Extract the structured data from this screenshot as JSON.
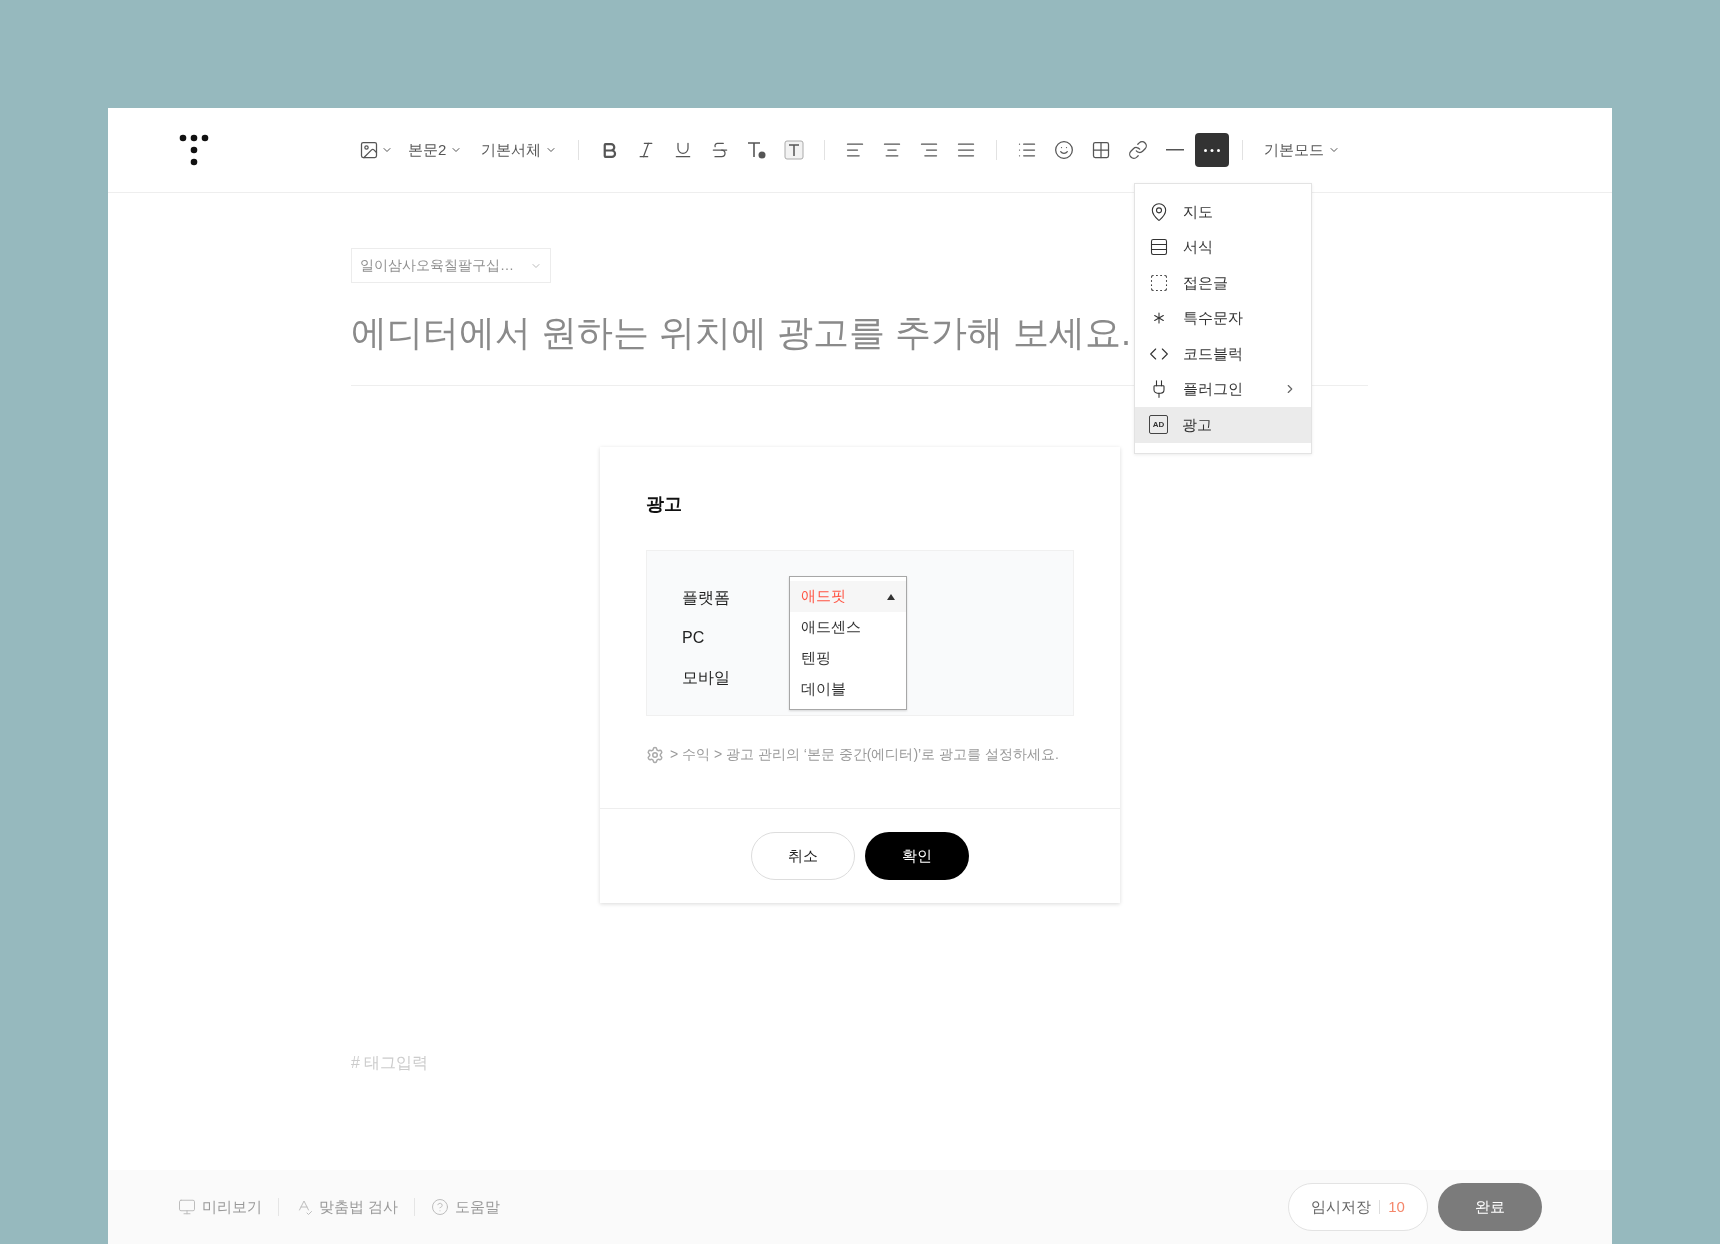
{
  "toolbar": {
    "groups": [
      [
        {
          "kind": "image",
          "active": false
        },
        {
          "kind": "dropdown",
          "label": "본문2",
          "active": false
        },
        {
          "kind": "dropdown",
          "label": "기본서체",
          "active": false
        }
      ],
      [
        {
          "kind": "bold",
          "active": false
        },
        {
          "kind": "italic",
          "active": false
        },
        {
          "kind": "underline",
          "active": false
        },
        {
          "kind": "strikethrough",
          "active": false
        },
        {
          "kind": "text-color",
          "active": false
        },
        {
          "kind": "text-background",
          "active": false
        }
      ],
      [
        {
          "kind": "align-left",
          "active": false
        },
        {
          "kind": "align-center",
          "active": false
        },
        {
          "kind": "align-right",
          "active": false
        },
        {
          "kind": "align-justify",
          "active": false
        }
      ],
      [
        {
          "kind": "bullet-list",
          "active": false
        },
        {
          "kind": "emoji",
          "active": false
        },
        {
          "kind": "table",
          "active": false
        },
        {
          "kind": "link",
          "active": false
        },
        {
          "kind": "horizontal-rule",
          "active": false
        },
        {
          "kind": "more",
          "active": true
        }
      ],
      [
        {
          "kind": "dropdown",
          "label": "기본모드",
          "active": false
        }
      ]
    ]
  },
  "more_menu": {
    "items": [
      {
        "kind": "map",
        "label": "지도",
        "selected": false,
        "submenu": false
      },
      {
        "kind": "template",
        "label": "서식",
        "selected": false,
        "submenu": false
      },
      {
        "kind": "fold",
        "label": "접은글",
        "selected": false,
        "submenu": false
      },
      {
        "kind": "special-char",
        "label": "특수문자",
        "selected": false,
        "submenu": false
      },
      {
        "kind": "code",
        "label": "코드블럭",
        "selected": false,
        "submenu": false
      },
      {
        "kind": "plugin",
        "label": "플러그인",
        "selected": false,
        "submenu": true
      },
      {
        "kind": "ad",
        "icon_text": "AD",
        "label": "광고",
        "selected": true,
        "submenu": false
      }
    ]
  },
  "category": {
    "value": "일이삼사오육칠팔구십…"
  },
  "title": {
    "placeholder": "에디터에서 원하는 위치에 광고를 추가해 보세요."
  },
  "tags": {
    "placeholder": "# 태그입력"
  },
  "dialog": {
    "title": "광고",
    "labels": [
      "플랫폼",
      "PC",
      "모바일"
    ],
    "platform_options": [
      {
        "label": "애드핏",
        "selected": true
      },
      {
        "label": "애드센스",
        "selected": false
      },
      {
        "label": "텐핑",
        "selected": false
      },
      {
        "label": "데이블",
        "selected": false
      }
    ],
    "hint": "> 수익 > 광고 관리의 ‘본문 중간(에디터)’로 광고를 설정하세요.",
    "buttons": [
      {
        "kind": "secondary",
        "label": "취소"
      },
      {
        "kind": "primary",
        "label": "확인"
      }
    ]
  },
  "footer": {
    "links": [
      {
        "kind": "preview",
        "label": "미리보기"
      },
      {
        "kind": "spellcheck",
        "label": "맞춤법 검사"
      },
      {
        "kind": "help",
        "label": "도움말"
      }
    ],
    "save": {
      "label": "임시저장",
      "count": "10"
    },
    "done": {
      "label": "완료"
    }
  }
}
